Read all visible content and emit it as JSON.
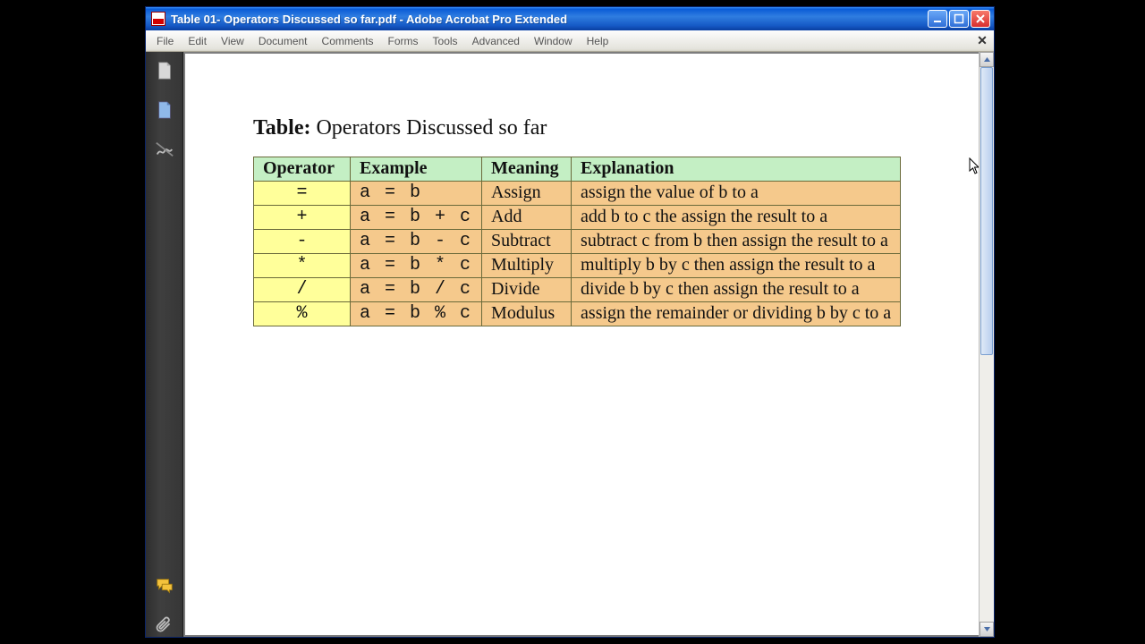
{
  "window": {
    "title": "Table 01- Operators Discussed so far.pdf - Adobe Acrobat Pro Extended"
  },
  "menu": [
    "File",
    "Edit",
    "View",
    "Document",
    "Comments",
    "Forms",
    "Tools",
    "Advanced",
    "Window",
    "Help"
  ],
  "document": {
    "title_label": "Table:",
    "title_text": "Operators Discussed so far"
  },
  "table": {
    "headers": [
      "Operator",
      "Example",
      "Meaning",
      "Explanation"
    ],
    "rows": [
      {
        "op": "=",
        "ex": "a = b",
        "mn": "Assign",
        "ep": "assign the value of b to a"
      },
      {
        "op": "+",
        "ex": "a = b + c",
        "mn": "Add",
        "ep": "add b to c the assign the result to a"
      },
      {
        "op": "-",
        "ex": "a = b - c",
        "mn": "Subtract",
        "ep": "subtract c from b then assign the result to a"
      },
      {
        "op": "*",
        "ex": "a = b * c",
        "mn": "Multiply",
        "ep": "multiply b by c then assign the result to a"
      },
      {
        "op": "/",
        "ex": "a = b / c",
        "mn": "Divide",
        "ep": "divide b by c then assign the result to a"
      },
      {
        "op": "%",
        "ex": "a = b % c",
        "mn": "Modulus",
        "ep": "assign the remainder or dividing b by c to a"
      }
    ]
  }
}
